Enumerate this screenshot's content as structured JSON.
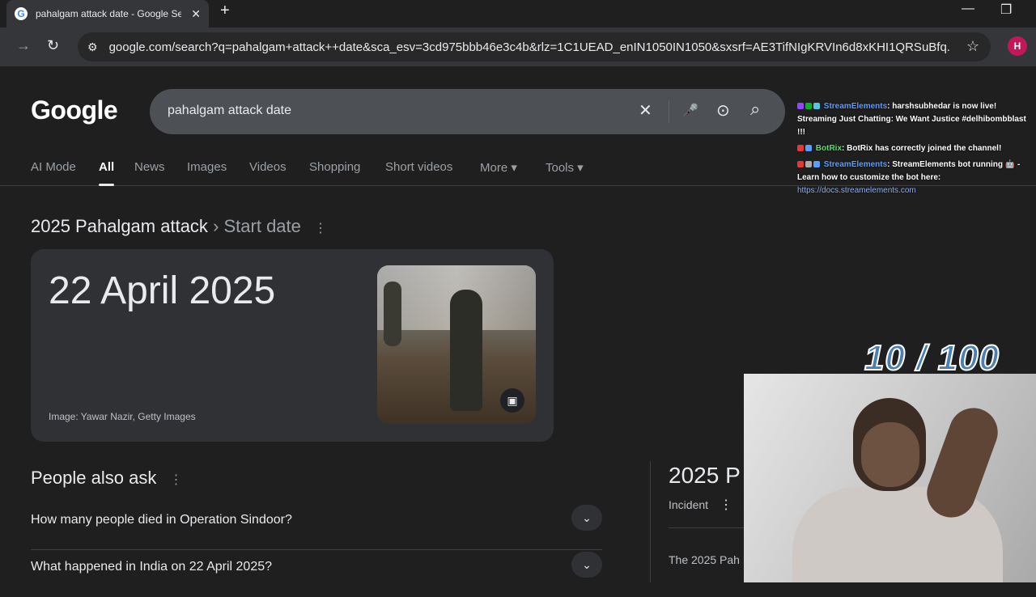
{
  "browser": {
    "tab_title": "pahalgam attack date - Google Search",
    "tab_close": "✕",
    "new_tab": "+",
    "minimize": "—",
    "restore": "❐",
    "back": "←",
    "forward": "→",
    "reload": "↻",
    "url": "google.com/search?q=pahalgam+attack++date&sca_esv=3cd975bbb46e3c4b&rlz=1C1UEAD_enIN1050IN1050&sxsrf=AE3TifNIgKRVIn6d8xKHI1QRSuBfq...",
    "bookmark_star": "☆",
    "profile_initial": "H"
  },
  "google": {
    "logo": "Google",
    "query": "pahalgam attack date",
    "clear": "✕",
    "mic": "🎤",
    "lens": "⊙",
    "search": "⌕",
    "tabs": [
      {
        "label": "AI Mode"
      },
      {
        "label": "All"
      },
      {
        "label": "News"
      },
      {
        "label": "Images"
      },
      {
        "label": "Videos"
      },
      {
        "label": "Shopping"
      },
      {
        "label": "Short videos"
      },
      {
        "label": "More ▾"
      },
      {
        "label": "Tools ▾"
      }
    ],
    "result_head": "2025 Pahalgam attack",
    "result_sub": "› Start date",
    "answer": "22 April 2025",
    "credit": "Image: Yawar Nazir, Getty Images",
    "image_icon": "▣",
    "paa_title": "People also ask",
    "paa": [
      {
        "q": "How many people died in Operation Sindoor?"
      },
      {
        "q": "What happened in India on 22 April 2025?"
      }
    ],
    "chevron": "⌄",
    "kp_title": "2025 P",
    "kp_sub": "Incident",
    "kp_text": "The 2025 Pah",
    "kebab": "⋮"
  },
  "overlay": {
    "chat": [
      {
        "user": "StreamElements",
        "msg": ": harshsubhedar is now live! Streaming Just Chatting: We Want Justice #delhibombblast !!!"
      },
      {
        "user": "BotRix",
        "msg": ": BotRix has correctly joined the channel!"
      },
      {
        "user": "StreamElements",
        "msg": ": StreamElements bot running 🤖 - Learn how to customize the bot here:"
      }
    ],
    "chat_link": "https://docs.streamelements.com",
    "counter": "10 / 100"
  },
  "colors": {
    "page_bg": "#1f1f1f",
    "card_bg": "#303134",
    "chat_user": "#5c9dff",
    "chat_bot": "#55e06a",
    "counter": "#4a7fb5"
  }
}
